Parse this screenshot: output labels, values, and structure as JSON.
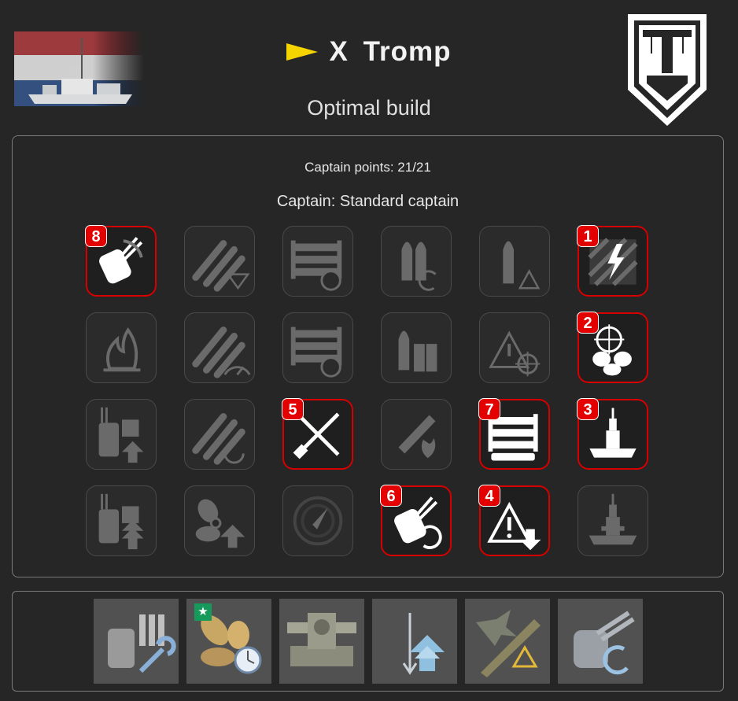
{
  "header": {
    "tier": "X",
    "ship_name": "Tromp",
    "subtitle": "Optimal build",
    "ship_image": "ship-thumbnail-netherlands-flag",
    "nation_emblem": "netherlands-crane-emblem-icon",
    "colors": {
      "tier_flag": "#f5d400",
      "background": "#262626"
    }
  },
  "captain": {
    "points_text": "Captain points: 21/21",
    "captain_text": "Captain: Standard captain"
  },
  "skills": [
    [
      {
        "icon": "main-battery-gun-icon",
        "selected": true,
        "order": "8"
      },
      {
        "icon": "torpedo-armament-icon",
        "selected": false,
        "order": ""
      },
      {
        "icon": "torpedo-reload-icon",
        "selected": false,
        "order": ""
      },
      {
        "icon": "shell-reload-icon",
        "selected": false,
        "order": ""
      },
      {
        "icon": "shell-warning-icon",
        "selected": false,
        "order": ""
      },
      {
        "icon": "electric-hazard-icon",
        "selected": true,
        "order": "1"
      }
    ],
    [
      {
        "icon": "fire-icon",
        "selected": false,
        "order": ""
      },
      {
        "icon": "torpedo-speed-icon",
        "selected": false,
        "order": ""
      },
      {
        "icon": "torpedo-timer-icon",
        "selected": false,
        "order": ""
      },
      {
        "icon": "ammo-stock-icon",
        "selected": false,
        "order": ""
      },
      {
        "icon": "warning-target-icon",
        "selected": false,
        "order": ""
      },
      {
        "icon": "helm-propeller-icon",
        "selected": true,
        "order": "2"
      }
    ],
    [
      {
        "icon": "turret-upgrade-icon",
        "selected": false,
        "order": ""
      },
      {
        "icon": "torpedo-cycle-icon",
        "selected": false,
        "order": ""
      },
      {
        "icon": "crossed-tools-icon",
        "selected": true,
        "order": "5"
      },
      {
        "icon": "fire-shield-icon",
        "selected": false,
        "order": ""
      },
      {
        "icon": "torpedo-rack-icon",
        "selected": true,
        "order": "7"
      },
      {
        "icon": "battleship-icon",
        "selected": true,
        "order": "3"
      }
    ],
    [
      {
        "icon": "turret-double-upgrade-icon",
        "selected": false,
        "order": ""
      },
      {
        "icon": "propeller-upgrade-icon",
        "selected": false,
        "order": ""
      },
      {
        "icon": "radar-compass-icon",
        "selected": false,
        "order": ""
      },
      {
        "icon": "turret-reload-icon",
        "selected": true,
        "order": "6"
      },
      {
        "icon": "warning-down-icon",
        "selected": true,
        "order": "4"
      },
      {
        "icon": "ship-silhouette-icon",
        "selected": false,
        "order": ""
      }
    ]
  ],
  "upgrades": [
    {
      "icon": "turret-repair-upgrade-icon",
      "special": false
    },
    {
      "icon": "propeller-timer-upgrade-icon",
      "special": true
    },
    {
      "icon": "steering-gear-upgrade-icon",
      "special": false
    },
    {
      "icon": "concealment-upgrade-icon",
      "special": false
    },
    {
      "icon": "aircraft-warning-upgrade-icon",
      "special": false
    },
    {
      "icon": "turret-reload-upgrade-icon",
      "special": false
    }
  ],
  "upgrade_special_badge": "★"
}
